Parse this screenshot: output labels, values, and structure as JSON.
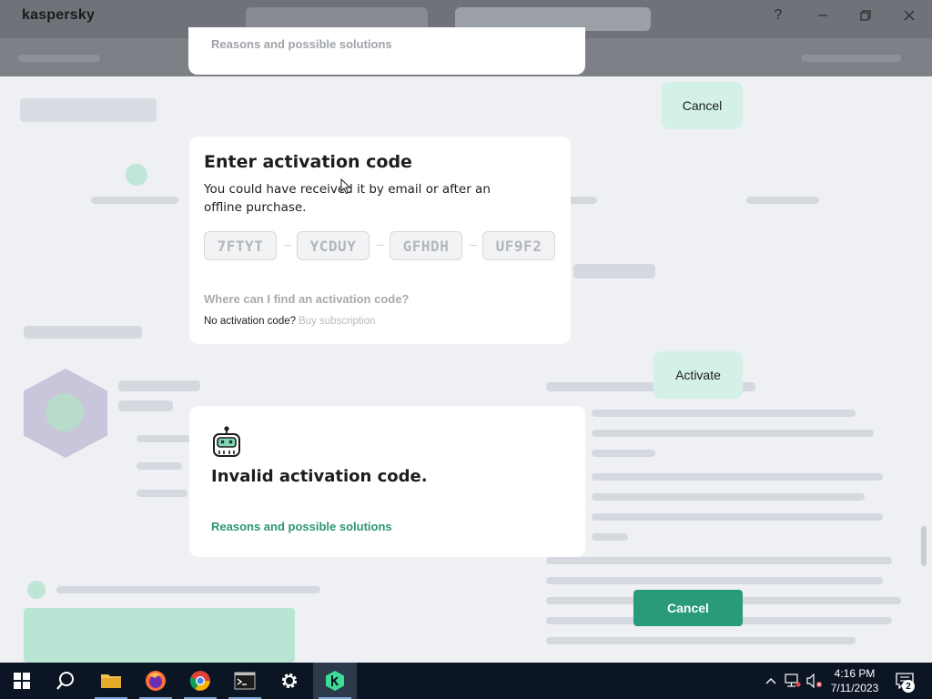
{
  "window": {
    "title": "kaspersky",
    "help": "?",
    "minimize": "—",
    "maximize": "❐",
    "close": "✕"
  },
  "top_card": {
    "link": "Reasons and possible solutions"
  },
  "buttons": {
    "cancel_top": "Cancel",
    "activate": "Activate",
    "cancel_primary": "Cancel"
  },
  "activation_dialog": {
    "title": "Enter activation code",
    "description": "You could have received it by email or after an offline purchase.",
    "code_parts": [
      "7FTYT",
      "YCDUY",
      "GFHDH",
      "UF9F2"
    ],
    "help_link": "Where can I find an activation code?",
    "no_code_text": "No activation code?",
    "buy_link": "Buy subscription"
  },
  "error_dialog": {
    "title": "Invalid activation code.",
    "link": "Reasons and possible solutions"
  },
  "taskbar": {
    "time": "4:16 PM",
    "date": "7/11/2023",
    "notifications_count": "2"
  },
  "colors": {
    "accent": "#2a9b7a",
    "link_green": "#2d9478",
    "ghost_button": "#d3f1e6"
  }
}
